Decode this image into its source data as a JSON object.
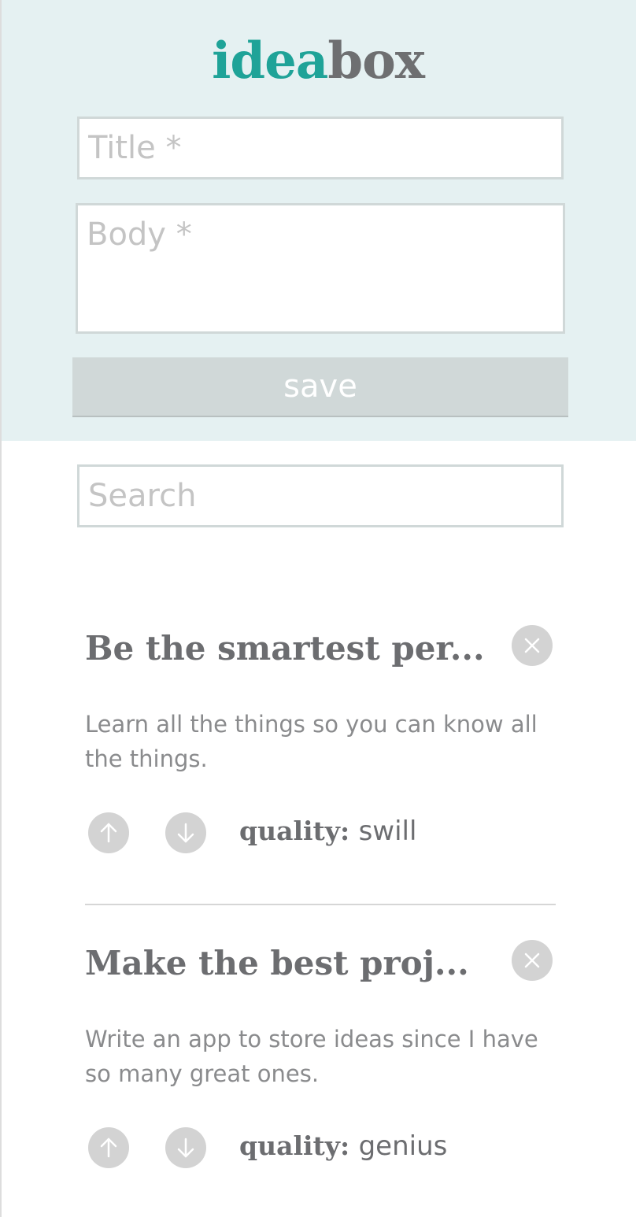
{
  "app": {
    "logo_part1": "idea",
    "logo_part2": "box",
    "logo_part1_color": "#1fa398",
    "logo_part2_color": "#6e6f71",
    "header_bg": "#e5f1f2"
  },
  "form": {
    "title_placeholder": "Title *",
    "body_placeholder": "Body *",
    "save_label": "save"
  },
  "search": {
    "placeholder": "Search"
  },
  "ideas": [
    {
      "title": "Be the smartest per...",
      "body": "Learn all the things so you can know all the things.",
      "quality_label": "quality:",
      "quality": "swill",
      "delete_icon": "close-icon",
      "upvote_icon": "arrow-up-icon",
      "downvote_icon": "arrow-down-icon"
    },
    {
      "title": "Make the best proj...",
      "body": "Write an app to store ideas since I have so many great ones.",
      "quality_label": "quality:",
      "quality": "genius",
      "delete_icon": "close-icon",
      "upvote_icon": "arrow-up-icon",
      "downvote_icon": "arrow-down-icon"
    }
  ]
}
